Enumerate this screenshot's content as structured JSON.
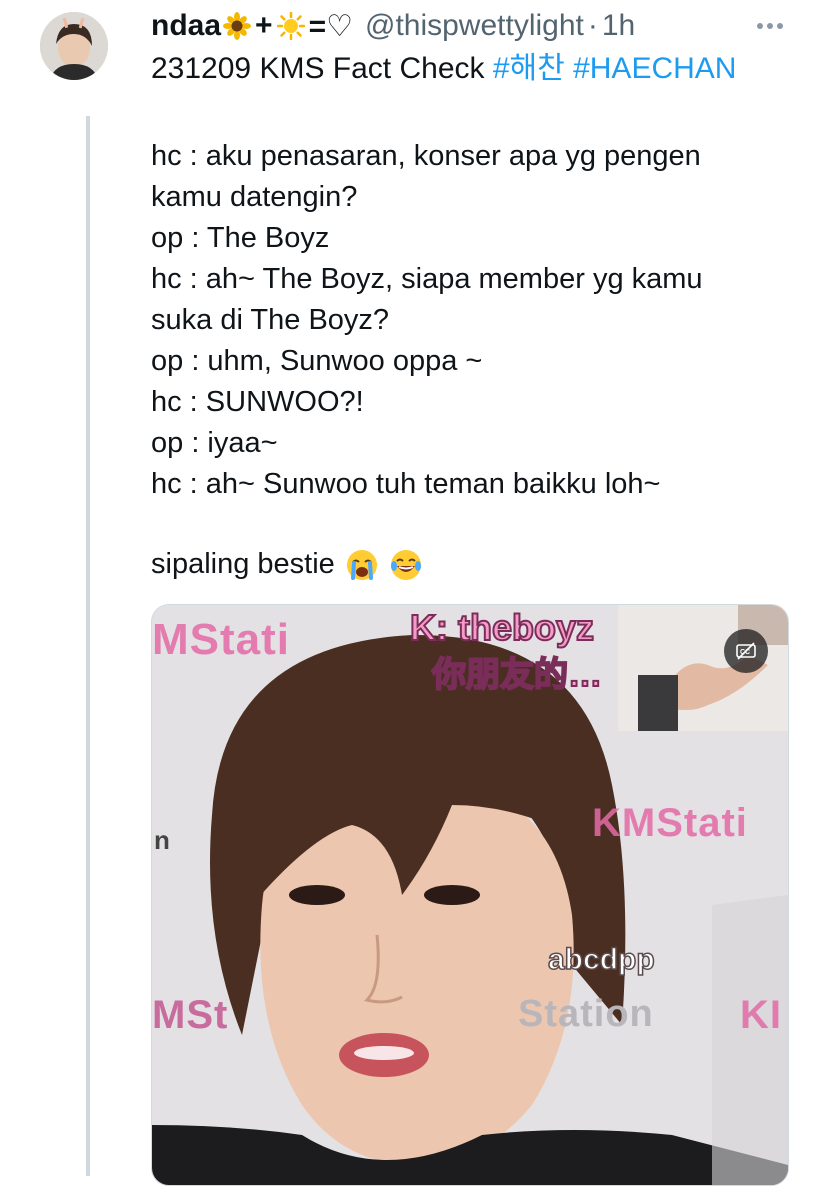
{
  "tweet": {
    "display_name": "ndaa",
    "name_emojis": [
      "sunflower-emoji",
      "sun-emoji"
    ],
    "name_plus": "+",
    "name_equals": "=♡",
    "handle": "@thispwettylight",
    "separator": "·",
    "time": "1h",
    "title_text": "231209 KMS Fact Check ",
    "hashtags": [
      "#해찬",
      "#HAECHAN"
    ],
    "body_lines": [
      "hc : aku penasaran, konser apa yg pengen",
      "kamu datengin?",
      "op : The Boyz",
      "hc : ah~ The Boyz, siapa member yg kamu",
      "suka di The Boyz?",
      "op : uhm, Sunwoo oppa ~",
      "hc : SUNWOO?!",
      "op : iyaa~",
      "hc : ah~ Sunwoo tuh teman baikku loh~"
    ],
    "closing_text": "sipaling bestie",
    "closing_emojis": [
      "loudly-crying-face-emoji",
      "tears-of-joy-emoji"
    ]
  },
  "media": {
    "caption_line1": "K: theboyz",
    "caption_line2": "你朋友的…",
    "watermark_top": "MStati",
    "watermark_right": "KMStati",
    "watermark_bottom_left": "MSt",
    "watermark_bottom_mid": "Station",
    "watermark_bottom_right": "KI",
    "watermark_left_fragment": "n",
    "overlay_user": "abcdpp"
  },
  "colors": {
    "hashtag": "#1d9bf0",
    "handle": "#536471",
    "thread_line": "#cfd9de",
    "watermark_pink": "#e36aa6"
  }
}
